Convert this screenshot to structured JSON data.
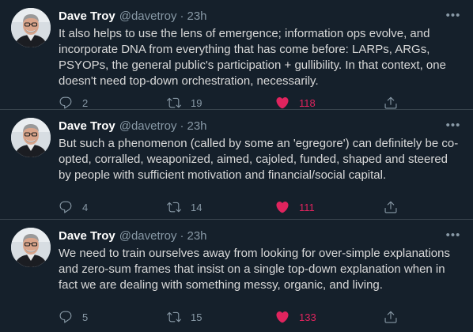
{
  "colors": {
    "background": "#15202b",
    "divider": "#38444d",
    "name": "#ffffff",
    "secondary": "#8899a6",
    "body_text": "#d9d9d9",
    "like_active": "#e0245e"
  },
  "tweets": [
    {
      "name": "Dave Troy",
      "handle": "@davetroy",
      "separator": "·",
      "time": "23h",
      "text": "It also helps to use the lens of emergence; information ops evolve, and incorporate DNA from everything that has come before: LARPs, ARGs, PSYOPs, the general public's participation + gullibility. In that context, one doesn't need top-down orchestration, necessarily.",
      "replies": "2",
      "retweets": "19",
      "likes": "118",
      "liked": true
    },
    {
      "name": "Dave Troy",
      "handle": "@davetroy",
      "separator": "·",
      "time": "23h",
      "text": "But such a phenomenon (called by some an 'egregore') can definitely be co-opted, corralled, weaponized, aimed, cajoled, funded, shaped and steered by people with sufficient motivation and financial/social capital.",
      "replies": "4",
      "retweets": "14",
      "likes": "111",
      "liked": true
    },
    {
      "name": "Dave Troy",
      "handle": "@davetroy",
      "separator": "·",
      "time": "23h",
      "text": "We need to train ourselves away from looking for over-simple explanations and zero-sum frames that insist on a single top-down explanation when in fact we are dealing with something messy, organic, and living.",
      "replies": "5",
      "retweets": "15",
      "likes": "133",
      "liked": true
    }
  ],
  "icons": {
    "reply": "reply-icon",
    "retweet": "retweet-icon",
    "like": "heart-icon",
    "share": "share-icon",
    "more": "more-icon"
  }
}
